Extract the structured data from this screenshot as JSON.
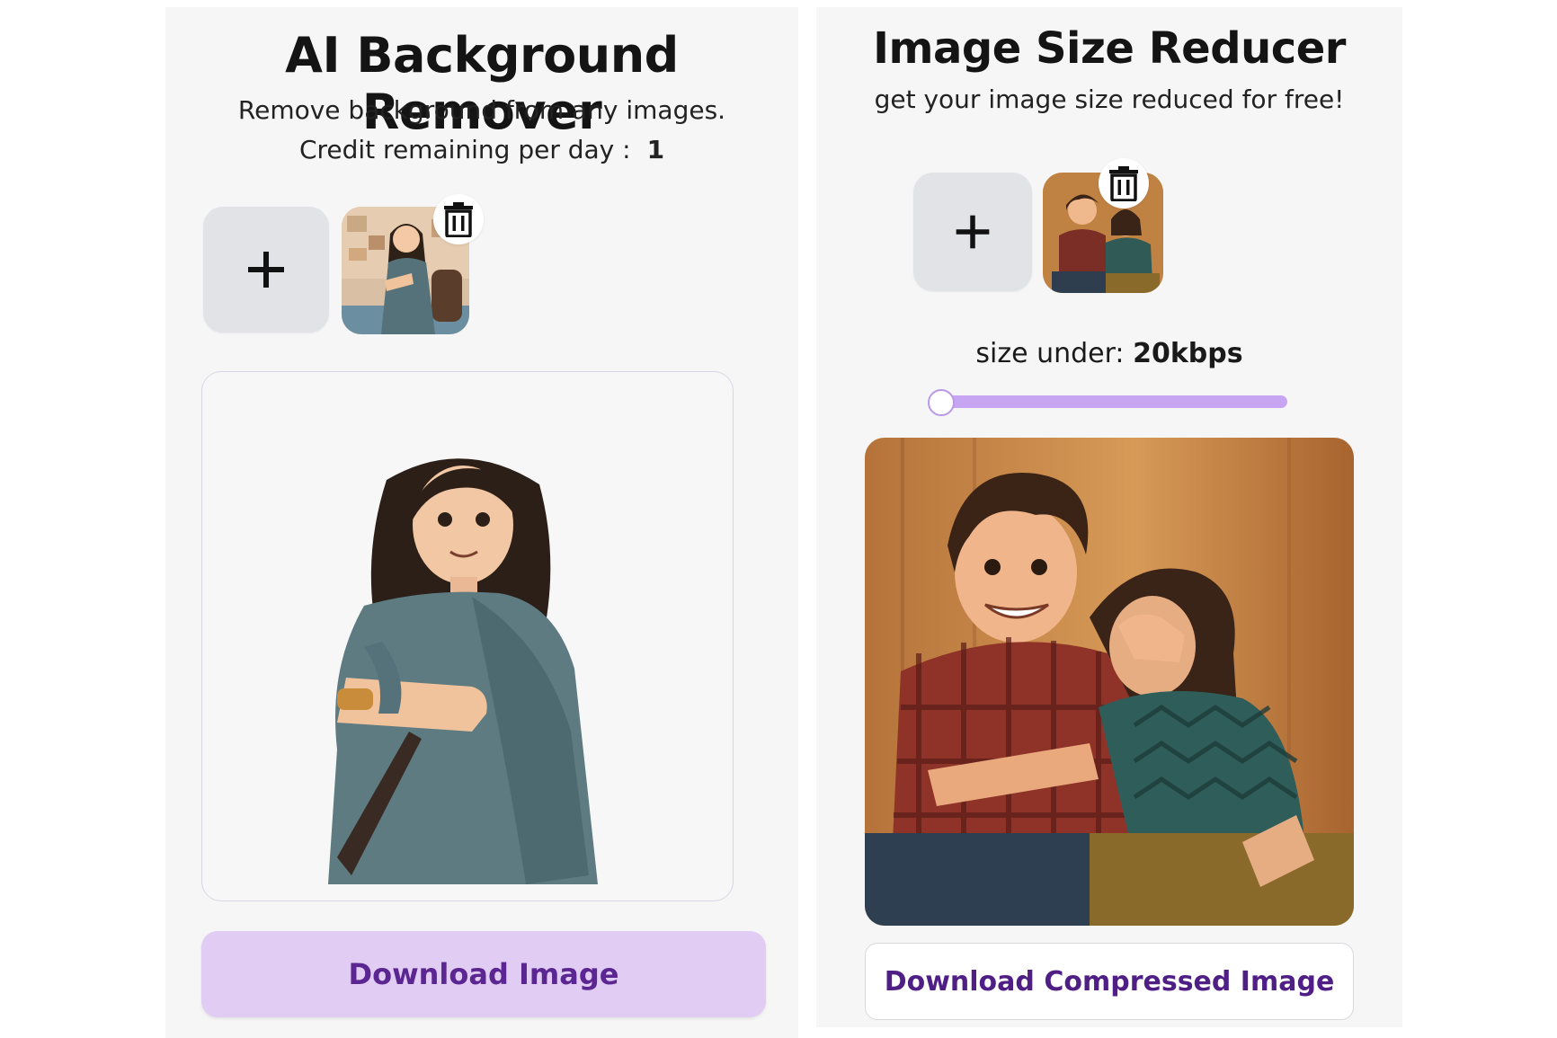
{
  "left_panel": {
    "title": "AI Background Remover",
    "subtitle": "Remove background from any images.",
    "credit_label": "Credit remaining per day :",
    "credit_value": "1",
    "download_label": "Download Image"
  },
  "right_panel": {
    "title": "Image Size Reducer",
    "subtitle": "get your image size reduced for free!",
    "size_label": "size under:",
    "size_value": "20kbps",
    "slider_level": 0,
    "download_label": "Download Compressed Image"
  },
  "icons": {
    "add": "plus-icon",
    "delete": "trash-icon"
  },
  "colors": {
    "accent": "#c7a5f3",
    "primary_button_bg": "#e1cdf4",
    "button_text": "#5b2691",
    "panel_bg": "#f6f6f6",
    "tile_bg": "#e2e3e7"
  }
}
